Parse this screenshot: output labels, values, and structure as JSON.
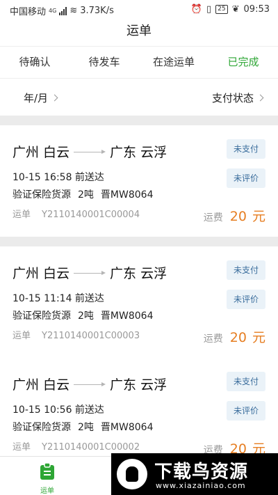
{
  "statusbar": {
    "carrier": "中国移动",
    "net_type": "4G",
    "speed": "3.73K/s",
    "battery": "25",
    "time": "09:53"
  },
  "header": {
    "title": "运单"
  },
  "tabs": [
    {
      "label": "待确认"
    },
    {
      "label": "待发车"
    },
    {
      "label": "在途运单"
    },
    {
      "label": "已完成"
    }
  ],
  "active_tab_color": "#2ea635",
  "filters": {
    "date": "年/月",
    "pay_status": "支付状态"
  },
  "orders": [
    {
      "from": "广州 白云",
      "to": "广东 云浮",
      "time": "10-15 16:58 前送达",
      "cargo": "验证保险货源",
      "weight": "2吨",
      "plate": "晋MW8064",
      "order_label": "运单",
      "order_no": "Y2110140001C00004",
      "pay_status": "未支付",
      "eval_status": "未评价",
      "fee_label": "运费",
      "fee_amount": "20",
      "fee_unit": "元"
    },
    {
      "from": "广州 白云",
      "to": "广东 云浮",
      "time": "10-15 11:14 前送达",
      "cargo": "验证保险货源",
      "weight": "2吨",
      "plate": "晋MW8064",
      "order_label": "运单",
      "order_no": "Y2110140001C00003",
      "pay_status": "未支付",
      "eval_status": "未评价",
      "fee_label": "运费",
      "fee_amount": "20",
      "fee_unit": "元"
    },
    {
      "from": "广州 白云",
      "to": "广东 云浮",
      "time": "10-15 10:56 前送达",
      "cargo": "验证保险货源",
      "weight": "2吨",
      "plate": "晋MW8064",
      "order_label": "运单",
      "order_no": "Y2110140001C00002",
      "pay_status": "未支付",
      "eval_status": "未评价",
      "fee_label": "运费",
      "fee_amount": "20",
      "fee_unit": "元"
    }
  ],
  "bottom_nav": {
    "waybill_label": "运单"
  },
  "watermark": {
    "title": "下载鸟资源",
    "url": "www.xiazainiao.com"
  }
}
